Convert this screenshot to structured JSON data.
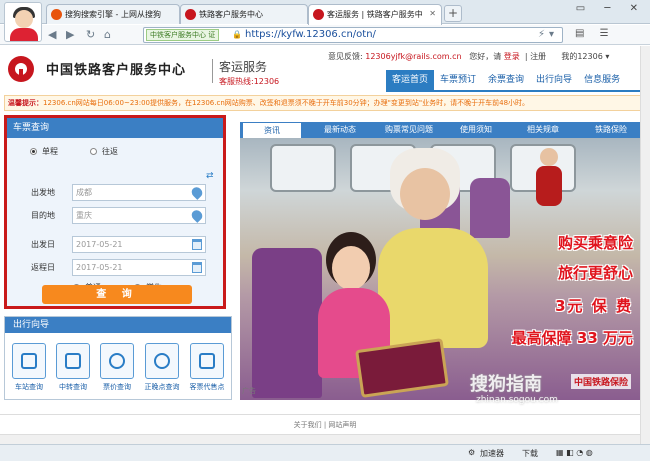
{
  "browser": {
    "tabs": [
      {
        "title": "搜狗搜索引擎 - 上网从搜狗",
        "color": "#e8540c"
      },
      {
        "title": "铁路客户服务中心",
        "color": "#c7161e"
      },
      {
        "title": "客运服务 | 铁路客户服务中",
        "color": "#c7161e"
      }
    ],
    "new_tab": "+",
    "window_controls": "▭ ─ ✕",
    "site_badge": "中铁客户服务中心 证",
    "url": "https://kyfw.12306.cn/otn/",
    "nav_glyphs": {
      "back": "◀",
      "forward": "▶",
      "refresh": "↻",
      "home": "⌂"
    }
  },
  "header": {
    "site_title": "中国铁路客户服务中心",
    "service_name": "客运服务",
    "hotline": "客服热线:12306",
    "top_links": {
      "feedback_label": "意见反馈:",
      "feedback_email": "12306yjfk@rails.com.cn",
      "greeting": "您好，请",
      "login": "登录",
      "register": "注册",
      "my12306": "我的12306 ▾"
    },
    "nav": [
      "客运首页",
      "车票预订",
      "余票查询",
      "出行向导",
      "信息服务"
    ]
  },
  "notice": {
    "label": "温馨提示：",
    "text": "12306.cn网站每日06:00~23:00提供服务，在12306.cn网站购票、改签和退票须不晚于开车前30分钟；办理\"变更到站\"业务时，请不晚于开车前48小时。"
  },
  "query": {
    "title": "车票查询",
    "trip_types": [
      "单程",
      "往返"
    ],
    "from_label": "出发地",
    "from_value": "成都",
    "to_label": "目的地",
    "to_value": "重庆",
    "depart_label": "出发日",
    "depart_value": "2017-05-21",
    "return_label": "返程日",
    "return_value": "2017-05-21",
    "passenger_types": [
      "普通",
      "学生"
    ],
    "search_label": "查 询"
  },
  "guide": {
    "title": "出行向导",
    "items": [
      "车站查询",
      "中转查询",
      "票价查询",
      "正晚点查询",
      "客票代售点"
    ]
  },
  "info_tabs": [
    "资讯",
    "最新动态",
    "购票常见问题",
    "使用须知",
    "相关规章",
    "铁路保险"
  ],
  "banner": {
    "lines": [
      "购买乘意险",
      "旅行更舒心",
      "3元 保 费",
      "最高保障 33 万元"
    ],
    "insurer": "中国铁路保险",
    "ad_tag": "广告"
  },
  "footer": {
    "links": "关于我们 | 网站声明"
  },
  "watermark": {
    "main": "搜狗指南",
    "sub": "zhinan.sogou.com"
  },
  "status": {
    "accelerator": "加速器",
    "download": "下载"
  }
}
